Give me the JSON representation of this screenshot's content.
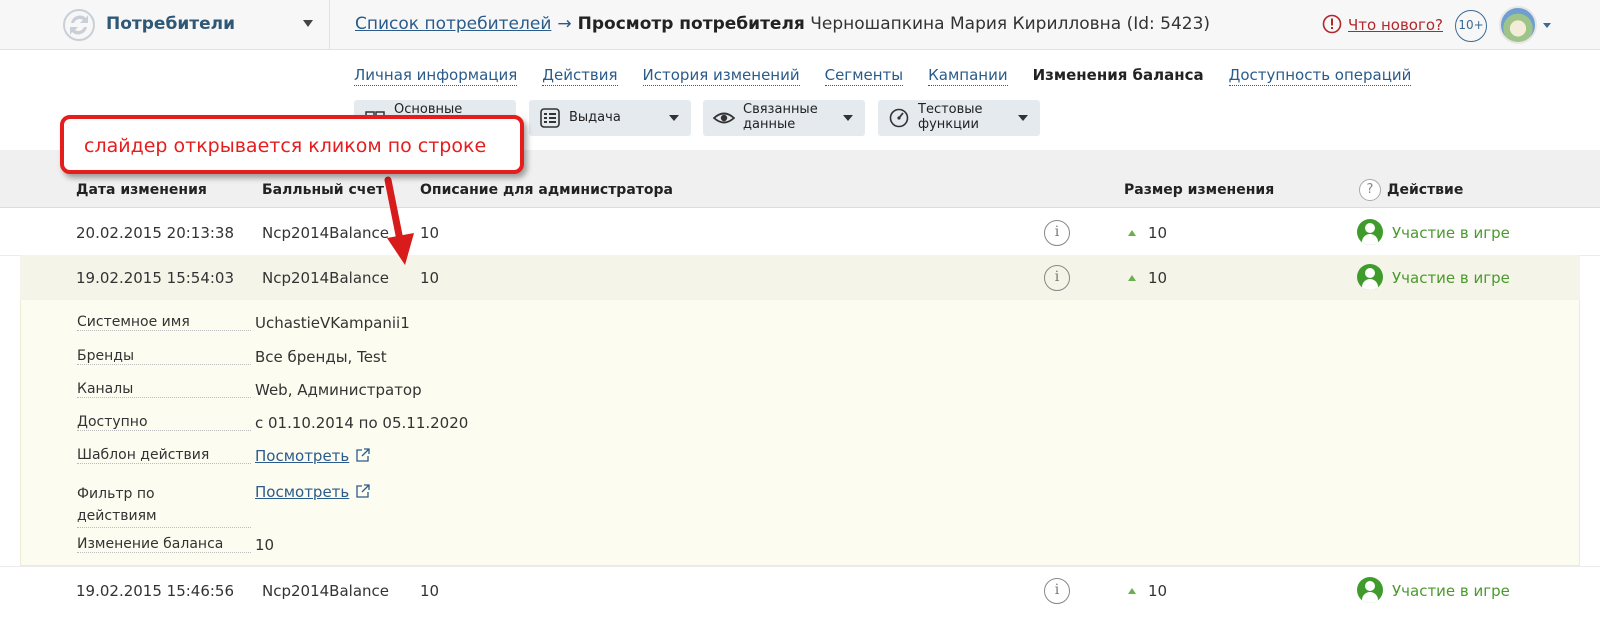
{
  "topbar": {
    "section_name": "Потребители",
    "breadcrumb_link": "Список потребителей",
    "breadcrumb_arrow": "→",
    "breadcrumb_current": "Просмотр потребителя",
    "breadcrumb_name": "Черношапкина Мария Кирилловна (Id: 5423)",
    "whats_new": "Что нового?",
    "badge": "10+"
  },
  "tabs": [
    {
      "label": "Личная информация",
      "active": false
    },
    {
      "label": "Действия",
      "active": false
    },
    {
      "label": "История изменений",
      "active": false
    },
    {
      "label": "Сегменты",
      "active": false
    },
    {
      "label": "Кампании",
      "active": false
    },
    {
      "label": "Изменения баланса",
      "active": true
    },
    {
      "label": "Доступность операций",
      "active": false
    }
  ],
  "toolbar": {
    "main_line1": "Основные",
    "issue": "Выдача",
    "related_line1": "Связанные",
    "related_line2": "данные",
    "test_line1": "Тестовые",
    "test_line2": "функции"
  },
  "callout": {
    "text": "слайдер открывается кликом по строке",
    "color": "#e51d1d"
  },
  "table": {
    "headers": {
      "date": "Дата изменения",
      "account": "Балльный счет",
      "description": "Описание для администратора",
      "size": "Размер изменения",
      "help": "?",
      "action": "Действие"
    },
    "rows": [
      {
        "date": "20.02.2015 20:13:38",
        "account": "Ncp2014Balance",
        "description": "10",
        "size": "10",
        "action": "Участие в игре"
      },
      {
        "date": "19.02.2015 15:54:03",
        "account": "Ncp2014Balance",
        "description": "10",
        "size": "10",
        "action": "Участие в игре"
      },
      {
        "date": "19.02.2015 15:46:56",
        "account": "Ncp2014Balance",
        "description": "10",
        "size": "10",
        "action": "Участие в игре"
      }
    ],
    "info_glyph": "i"
  },
  "details": {
    "system_name_label": "Системное имя",
    "system_name": "UchastieVKampanii1",
    "brands_label": "Бренды",
    "brands": "Все бренды, Test",
    "channels_label": "Каналы",
    "channels": "Web, Администратор",
    "available_label": "Доступно",
    "available": "с 01.10.2014 по 05.11.2020",
    "template_label": "Шаблон действия",
    "template_link": "Посмотреть",
    "filter_label_line1": "Фильтр по",
    "filter_label_line2": "действиям",
    "filter_link": "Посмотреть",
    "balance_label": "Изменение баланса",
    "balance": "10"
  },
  "colors": {
    "accent_green": "#4a9a2c",
    "link_blue": "#2a5b8a",
    "alert_red": "#b0282c"
  }
}
